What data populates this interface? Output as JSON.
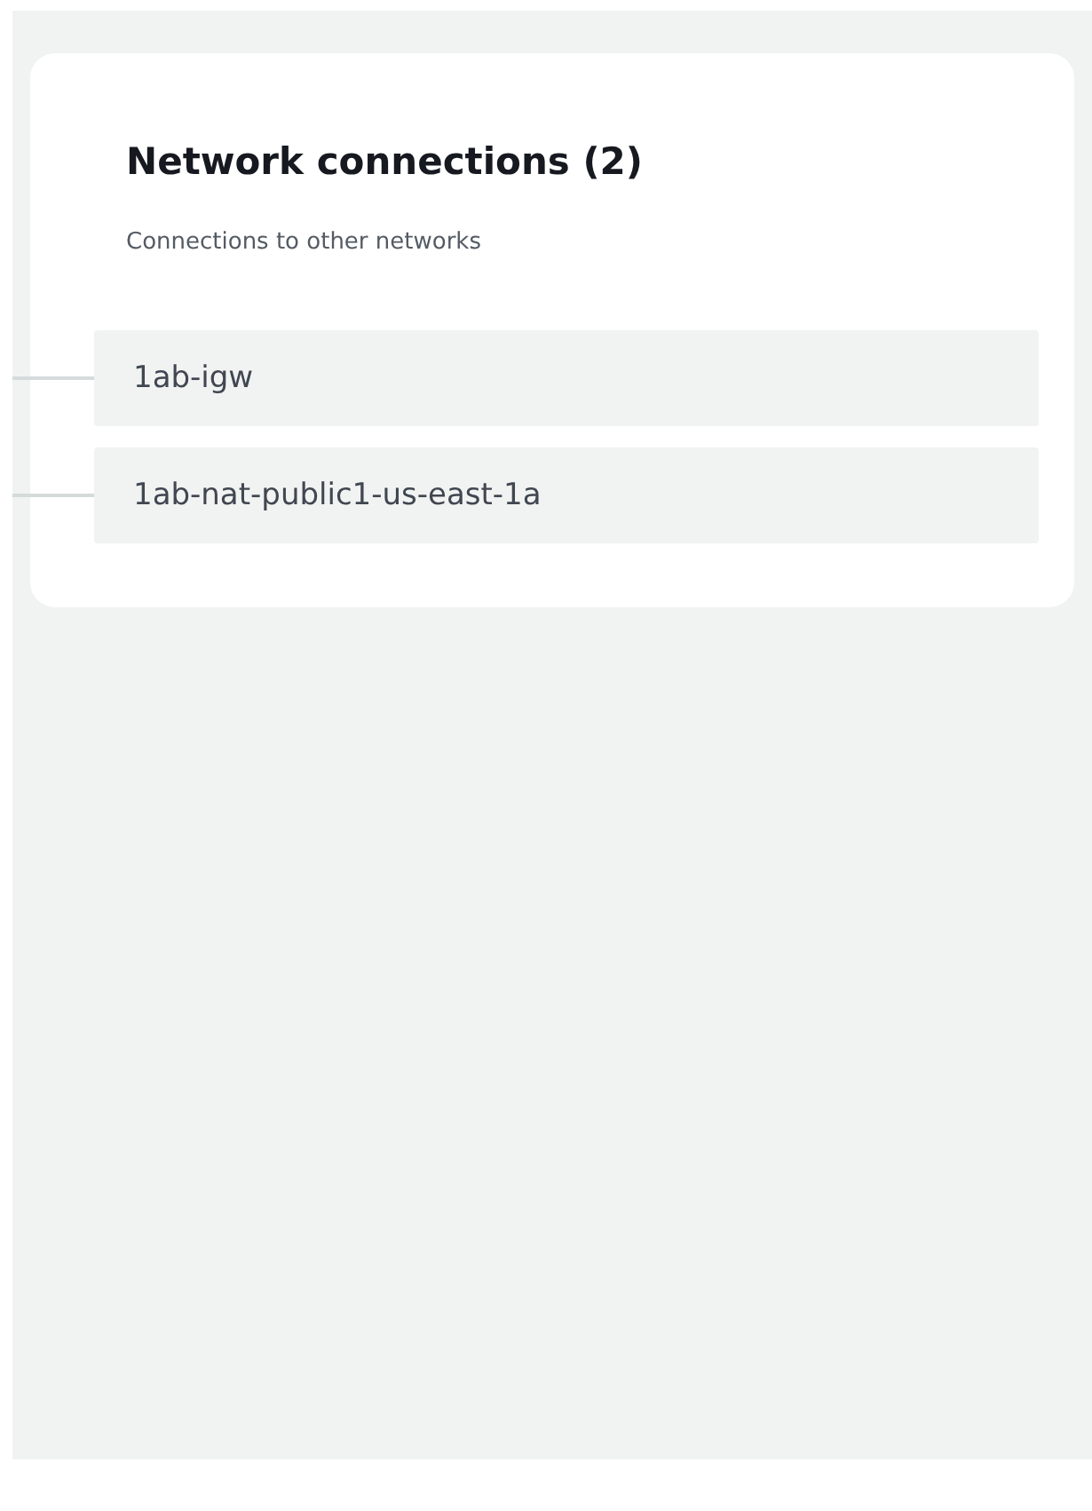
{
  "panel": {
    "title": "Network connections (2)",
    "description": "Connections to other networks",
    "connections": [
      {
        "name": "1ab-igw"
      },
      {
        "name": "1ab-nat-public1-us-east-1a"
      }
    ]
  }
}
